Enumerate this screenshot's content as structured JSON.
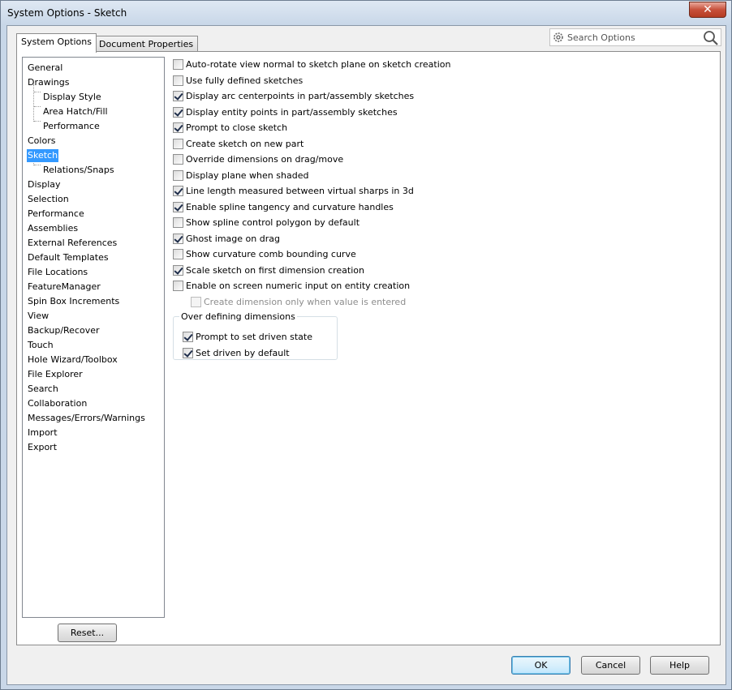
{
  "window": {
    "title": "System Options - Sketch",
    "close_glyph": "✕"
  },
  "tabs": [
    {
      "label": "System Options"
    },
    {
      "label": "Document Properties"
    }
  ],
  "search": {
    "placeholder": "Search Options",
    "gear_icon": "gear-icon",
    "magnifier_icon": "search-icon"
  },
  "tree": {
    "items": [
      {
        "label": "General"
      },
      {
        "label": "Drawings"
      },
      {
        "label": "Display Style"
      },
      {
        "label": "Area Hatch/Fill"
      },
      {
        "label": "Performance"
      },
      {
        "label": "Colors"
      },
      {
        "label": "Sketch"
      },
      {
        "label": "Relations/Snaps"
      },
      {
        "label": "Display"
      },
      {
        "label": "Selection"
      },
      {
        "label": "Performance"
      },
      {
        "label": "Assemblies"
      },
      {
        "label": "External References"
      },
      {
        "label": "Default Templates"
      },
      {
        "label": "File Locations"
      },
      {
        "label": "FeatureManager"
      },
      {
        "label": "Spin Box Increments"
      },
      {
        "label": "View"
      },
      {
        "label": "Backup/Recover"
      },
      {
        "label": "Touch"
      },
      {
        "label": "Hole Wizard/Toolbox"
      },
      {
        "label": "File Explorer"
      },
      {
        "label": "Search"
      },
      {
        "label": "Collaboration"
      },
      {
        "label": "Messages/Errors/Warnings"
      },
      {
        "label": "Import"
      },
      {
        "label": "Export"
      }
    ],
    "selected": "Sketch"
  },
  "options": [
    {
      "label": "Auto-rotate view normal to sketch plane on sketch creation",
      "checked": false
    },
    {
      "label": "Use fully defined sketches",
      "checked": false
    },
    {
      "label": "Display arc centerpoints in part/assembly sketches",
      "checked": true
    },
    {
      "label": "Display entity points in part/assembly sketches",
      "checked": true
    },
    {
      "label": "Prompt to close sketch",
      "checked": true
    },
    {
      "label": "Create sketch on new part",
      "checked": false
    },
    {
      "label": "Override dimensions on drag/move",
      "checked": false
    },
    {
      "label": "Display plane when shaded",
      "checked": false
    },
    {
      "label": "Line length measured between virtual sharps in 3d",
      "checked": true
    },
    {
      "label": "Enable spline tangency and curvature handles",
      "checked": true
    },
    {
      "label": "Show spline control polygon by default",
      "checked": false
    },
    {
      "label": "Ghost image on drag",
      "checked": true
    },
    {
      "label": "Show curvature comb bounding curve",
      "checked": false
    },
    {
      "label": "Scale sketch on first dimension creation",
      "checked": true
    },
    {
      "label": "Enable on screen numeric input on entity creation",
      "checked": false
    },
    {
      "label": "Create dimension only when value is entered",
      "checked": false,
      "disabled": true
    }
  ],
  "over_defining": {
    "title": "Over defining dimensions",
    "options": [
      {
        "label": "Prompt to set driven state",
        "checked": true
      },
      {
        "label": "Set driven by default",
        "checked": true
      }
    ]
  },
  "buttons": {
    "reset": "Reset...",
    "ok": "OK",
    "cancel": "Cancel",
    "help": "Help"
  }
}
